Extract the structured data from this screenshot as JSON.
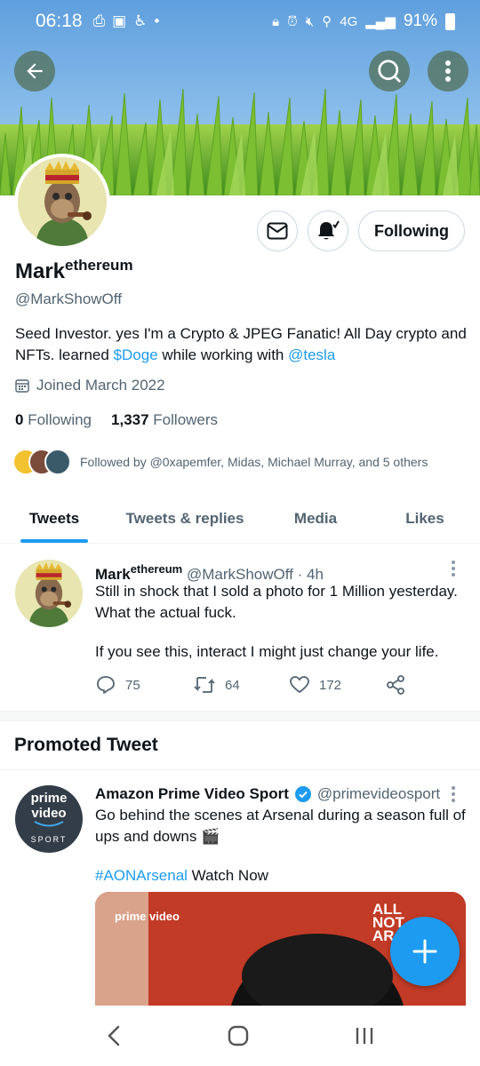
{
  "status_bar": {
    "time": "06:18",
    "network": "4G",
    "battery": "91%"
  },
  "profile": {
    "name": "Mark",
    "name_suffix": "ethereum",
    "handle": "@MarkShowOff",
    "bio_text_1": "Seed Investor. yes I'm a Crypto & JPEG Fanatic! All Day crypto and NFTs. learned ",
    "bio_link_1": "$Doge",
    "bio_text_2": " while working with ",
    "bio_link_2": "@tesla",
    "joined": "Joined March 2022",
    "following_count": "0",
    "following_label": "Following",
    "followers_count": "1,337",
    "followers_label": "Followers",
    "followed_by": "Followed by @0xapemfer, Midas, Michael Murray, and 5 others",
    "follow_button": "Following"
  },
  "tabs": [
    {
      "label": "Tweets",
      "active": true
    },
    {
      "label": "Tweets & replies",
      "active": false
    },
    {
      "label": "Media",
      "active": false
    },
    {
      "label": "Likes",
      "active": false
    }
  ],
  "tweet": {
    "name": "Mark",
    "name_suffix": "ethereum",
    "handle": "@MarkShowOff",
    "time": "· 4h",
    "line1": "Still in shock that I sold a photo for 1 Million yesterday. What the actual fuck.",
    "line2": "If you see this, interact I might just change your life.",
    "replies": "75",
    "retweets": "64",
    "likes": "172"
  },
  "promoted": {
    "section_title": "Promoted Tweet",
    "name": "Amazon Prime Video Sport",
    "handle": "@primevideosport",
    "avatar_line1": "prime",
    "avatar_line2": "video",
    "avatar_line3": "SPORT",
    "body1": "Go behind the scenes at Arsenal during a season full of ups and downs 🎬",
    "hashtag": "#AONArsenal",
    "cta": " Watch Now",
    "media_logo": "prime video",
    "media_text_1": "ALL",
    "media_text_2": "NOT",
    "media_text_3": "AR"
  },
  "colors": {
    "accent": "#1d9bf0",
    "text": "#0f1419",
    "muted": "#536471"
  }
}
